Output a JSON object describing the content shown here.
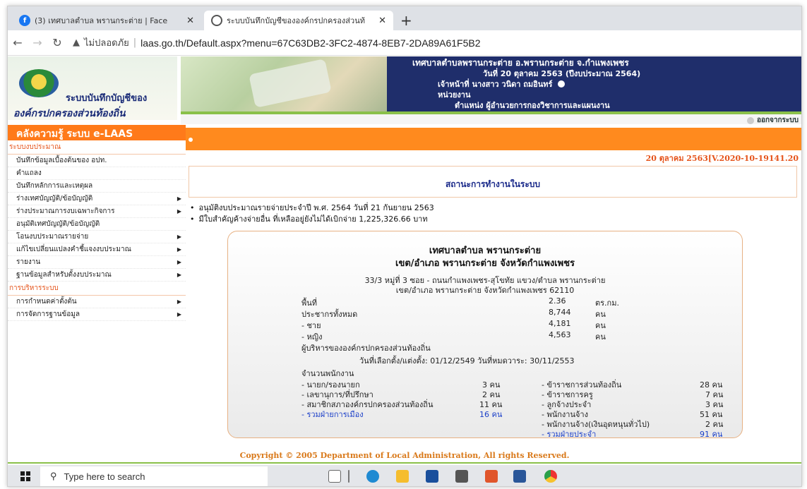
{
  "browser": {
    "tabs": [
      {
        "title": "(3) เทศบาลตำบล พรานกระต่าย | Face",
        "icon": "facebook-icon"
      },
      {
        "title": "ระบบบันทึกบัญชีขององค์กรปกครองส่วนท้",
        "icon": "laas-icon"
      }
    ],
    "insecure_label": "ไม่ปลอดภัย",
    "url": "laas.go.th/Default.aspx?menu=67C63DB2-3FC2-4874-8EB7-2DA89A61F5B2"
  },
  "header": {
    "brand_line1": "ระบบบันทึกบัญชีของ",
    "brand_line2": "องค์กรปกครองส่วนท้องถิ่น",
    "org": "เทศบาลตำบลพรานกระต่าย อ.พรานกระต่าย จ.กำแพงเพชร",
    "date": "วันที่ 20 ตุลาคม 2563  (ปีงบประมาณ 2564)",
    "officer_label": "เจ้าหน้าที่",
    "officer": "นางสาว วนิดา ถมอินทร์",
    "unit_label": "หน่วยงาน",
    "position_label": "ตำแหน่ง",
    "position": "ผู้อำนวยการกองวิชาการและแผนงาน",
    "logout": "ออกจากระบบ"
  },
  "sidebar": {
    "title": "คลังความรู้ ระบบ e-LAAS",
    "section1": "ระบบงบประมาณ",
    "items": [
      {
        "label": "บันทึกข้อมูลเบื้องต้นของ อปท.",
        "arrow": false
      },
      {
        "label": "คำแถลง",
        "arrow": false
      },
      {
        "label": "บันทึกหลักการและเหตุผล",
        "arrow": false
      },
      {
        "label": "ร่างเทศบัญญัติ/ข้อบัญญัติ",
        "arrow": true
      },
      {
        "label": "ร่างประมาณการงบเฉพาะกิจการ",
        "arrow": true
      },
      {
        "label": "อนุมัติเทศบัญญัติ/ข้อบัญญัติ",
        "arrow": false
      },
      {
        "label": "โอนงบประมาณรายจ่าย",
        "arrow": true
      },
      {
        "label": "แก้ไขเปลี่ยนแปลงคำชี้แจงงบประมาณ",
        "arrow": true
      },
      {
        "label": "รายงาน",
        "arrow": true
      },
      {
        "label": "ฐานข้อมูลสำหรับตั้งงบประมาณ",
        "arrow": true
      }
    ],
    "section2": "การบริหารระบบ",
    "items2": [
      {
        "label": "การกำหนดค่าตั้งต้น",
        "arrow": true
      },
      {
        "label": "การจัดการฐานข้อมูล",
        "arrow": true
      }
    ]
  },
  "main": {
    "date_version": "20 ตุลาคม 2563[V.2020-10-19141.20",
    "status_title": "สถานะการทำงานในระบบ",
    "bullets": [
      "อนุมัติงบประมาณรายจ่ายประจำปี พ.ศ. 2564 วันที่ 21 กันยายน 2563",
      "มีใบสำคัญค้างจ่ายอื่น ที่เหลืออยู่ยังไม่ได้เบิกจ่าย 1,225,326.66 บาท"
    ],
    "card": {
      "name": "เทศบาลตำบล พรานกระต่าย",
      "district": "เขต/อำเภอ พรานกระต่าย  จังหวัดกำแพงเพชร",
      "address1": "33/3 หมู่ที่ 3  ซอย -  ถนนกำแพงเพชร-สุโขทัย  แขวง/ตำบล พรานกระต่าย",
      "address2": "เขต/อำเภอ พรานกระต่าย  จังหวัดกำแพงเพชร  62110",
      "stats": [
        {
          "label": "พื้นที่",
          "value": "2.36",
          "unit": "ตร.กม."
        },
        {
          "label": "ประชากรทั้งหมด",
          "value": "8,744",
          "unit": "คน"
        },
        {
          "label": "- ชาย",
          "value": "4,181",
          "unit": "คน"
        },
        {
          "label": "- หญิง",
          "value": "4,563",
          "unit": "คน"
        }
      ],
      "exec_label": "ผู้บริหารขององค์กรปกครองส่วนท้องถิ่น",
      "exec_dates": "วันที่เลือกตั้ง/แต่งตั้ง: 01/12/2549    วันที่หมดวาระ: 30/11/2553",
      "staff_label": "จำนวนพนักงาน",
      "left_staff": [
        {
          "label": "- นายก/รองนายก",
          "count": "3 คน"
        },
        {
          "label": "- เลขานุการ/ที่ปรึกษา",
          "count": "2 คน"
        },
        {
          "label": "- สมาชิกสภาองค์กรปกครองส่วนท้องถิ่น",
          "count": "11 คน"
        },
        {
          "label": "- รวมฝ่ายการเมือง",
          "count": "16 คน"
        }
      ],
      "right_staff": [
        {
          "label": "- ข้าราชการส่วนท้องถิ่น",
          "count": "28 คน"
        },
        {
          "label": "- ข้าราชการครู",
          "count": "7 คน"
        },
        {
          "label": "- ลูกจ้างประจำ",
          "count": "3 คน"
        },
        {
          "label": "- พนักงานจ้าง",
          "count": "51 คน"
        },
        {
          "label": "- พนักงานจ้าง(เงินอุดหนุนทั่วไป)",
          "count": "2 คน"
        },
        {
          "label": "- รวมฝ่ายประจำ",
          "count": "91 คน"
        }
      ]
    },
    "copyright": "Copyright © 2005 Department of Local Administration, All rights Reserved."
  },
  "taskbar": {
    "search_placeholder": "Type here to search"
  }
}
